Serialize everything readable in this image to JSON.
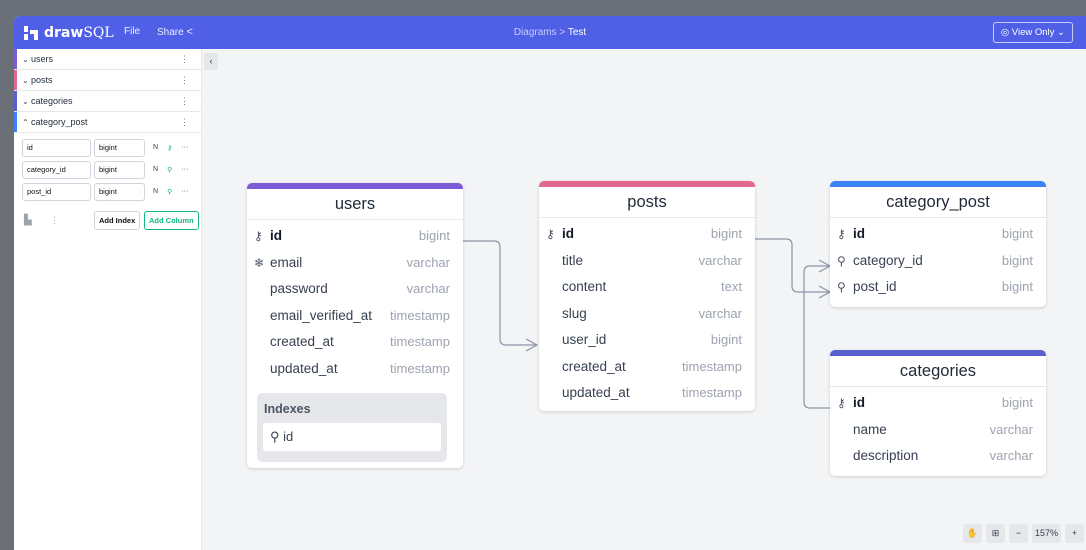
{
  "app": {
    "brand_bold": "draw",
    "brand_light": "SQL",
    "menu_file": "File",
    "menu_share": "Share",
    "breadcrumb_parent": "Diagrams",
    "breadcrumb_sep": ">",
    "breadcrumb_current": "Test",
    "view_only": "View Only",
    "accent_color": "#4f5fe6"
  },
  "sidebar": {
    "tables": [
      {
        "name": "users",
        "expanded": false,
        "color": "#7c5cd6"
      },
      {
        "name": "posts",
        "expanded": false,
        "color": "#e3688e"
      },
      {
        "name": "categories",
        "expanded": false,
        "color": "#5a5fd0"
      },
      {
        "name": "category_post",
        "expanded": true,
        "color": "#3b82f6"
      }
    ],
    "fields": [
      {
        "name": "id",
        "type": "bigint",
        "null_flag": "N"
      },
      {
        "name": "category_id",
        "type": "bigint",
        "null_flag": "N"
      },
      {
        "name": "post_id",
        "type": "bigint",
        "null_flag": "N"
      }
    ],
    "add_index_label": "Add Index",
    "add_column_label": "Add Column"
  },
  "tables": {
    "users": {
      "title": "users",
      "color": "#7c5cd6",
      "columns": [
        {
          "name": "id",
          "type": "bigint",
          "icon": "key-icon",
          "pk": true
        },
        {
          "name": "email",
          "type": "varchar",
          "icon": "unique-icon",
          "pk": false
        },
        {
          "name": "password",
          "type": "varchar",
          "icon": "",
          "pk": false
        },
        {
          "name": "email_verified_at",
          "type": "timestamp",
          "icon": "",
          "pk": false
        },
        {
          "name": "created_at",
          "type": "timestamp",
          "icon": "",
          "pk": false
        },
        {
          "name": "updated_at",
          "type": "timestamp",
          "icon": "",
          "pk": false
        }
      ],
      "indexes_label": "Indexes",
      "indexes": [
        "id"
      ]
    },
    "posts": {
      "title": "posts",
      "color": "#e3688e",
      "columns": [
        {
          "name": "id",
          "type": "bigint",
          "icon": "key-icon",
          "pk": true
        },
        {
          "name": "title",
          "type": "varchar",
          "icon": "",
          "pk": false
        },
        {
          "name": "content",
          "type": "text",
          "icon": "",
          "pk": false
        },
        {
          "name": "slug",
          "type": "varchar",
          "icon": "",
          "pk": false
        },
        {
          "name": "user_id",
          "type": "bigint",
          "icon": "",
          "pk": false
        },
        {
          "name": "created_at",
          "type": "timestamp",
          "icon": "",
          "pk": false
        },
        {
          "name": "updated_at",
          "type": "timestamp",
          "icon": "",
          "pk": false
        }
      ]
    },
    "category_post": {
      "title": "category_post",
      "color": "#3b82f6",
      "columns": [
        {
          "name": "id",
          "type": "bigint",
          "icon": "key-icon",
          "pk": true
        },
        {
          "name": "category_id",
          "type": "bigint",
          "icon": "index-icon",
          "pk": false
        },
        {
          "name": "post_id",
          "type": "bigint",
          "icon": "index-icon",
          "pk": false
        }
      ]
    },
    "categories": {
      "title": "categories",
      "color": "#5a5fd0",
      "columns": [
        {
          "name": "id",
          "type": "bigint",
          "icon": "key-icon",
          "pk": true
        },
        {
          "name": "name",
          "type": "varchar",
          "icon": "",
          "pk": false
        },
        {
          "name": "description",
          "type": "varchar",
          "icon": "",
          "pk": false
        }
      ]
    }
  },
  "zoom": {
    "level": "157%",
    "minus": "−",
    "plus": "+"
  }
}
